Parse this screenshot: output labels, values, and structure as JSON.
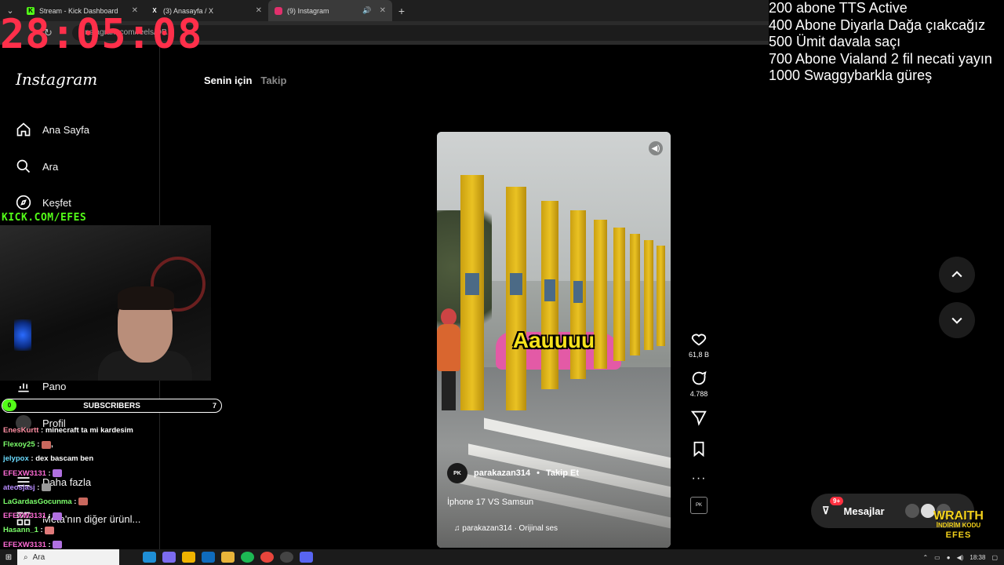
{
  "browser": {
    "tabs": [
      {
        "title": "Stream - Kick Dashboard",
        "favicon": "K",
        "color": "#53fc18"
      },
      {
        "title": "(3) Anasayfa / X",
        "favicon": "X",
        "color": "#ffffff"
      },
      {
        "title": "(9) Instagram",
        "favicon": "ig",
        "color": "#e1306c"
      }
    ],
    "url": "instagram.com/reels/DP..."
  },
  "overlay": {
    "timer": "28:05:08",
    "goals": [
      "200 abone TTS Active",
      "400 Abone Diyarla Dağa çıakcağız",
      "500 Ümit davala saçı",
      "700 Abone Vialand 2 fil necati yayın",
      "1000 Swaggybarkla güreş"
    ],
    "kick_url": "KICK.COM/EFES",
    "subscribers": {
      "label": "SUBSCRIBERS",
      "current": "0",
      "goal": "7"
    },
    "chat": [
      {
        "user": "EnesKurtt",
        "color": "#ff8fa3",
        "text": "minecraft ta mi kardesim"
      },
      {
        "user": "Flexoy25",
        "color": "#7cff6b",
        "text": ","
      },
      {
        "user": "jelypox",
        "color": "#6bdcff",
        "text": "dex bascam ben"
      },
      {
        "user": "EFEXW3131",
        "color": "#ff6bd6",
        "text": ""
      },
      {
        "user": "ateosjasj",
        "color": "#b88bff",
        "text": ""
      },
      {
        "user": "LaGardasGocunma",
        "color": "#7cff6b",
        "text": ""
      },
      {
        "user": "EFEXW3131",
        "color": "#ff6bd6",
        "text": ""
      },
      {
        "user": "Hasann_1",
        "color": "#7cff6b",
        "text": ""
      },
      {
        "user": "EFEXW3131",
        "color": "#ff6bd6",
        "text": ""
      }
    ],
    "sponsor": {
      "brand": "WRAITH",
      "line": "İNDİRİM KODU",
      "code": "EFES"
    }
  },
  "instagram": {
    "logo": "Instagram",
    "nav": {
      "home": "Ana Sayfa",
      "search": "Ara",
      "explore": "Keşfet",
      "dashboard": "Pano",
      "profile": "Profil",
      "more": "Daha fazla",
      "meta": "Meta'nın diğer ürünl..."
    },
    "feed_tabs": {
      "for_you": "Senin için",
      "following": "Takip"
    },
    "reel": {
      "caption_overlay": "Aauuuu",
      "username": "parakazan314",
      "follow": "Takip Et",
      "title": "İphone 17 VS Samsun",
      "audio": "parakazan314 · Orijinal ses",
      "likes": "61,8 B",
      "comments": "4.788"
    },
    "messages": {
      "label": "Mesajlar",
      "badge": "9+"
    }
  },
  "taskbar": {
    "search": "Ara",
    "time": "18:38"
  }
}
